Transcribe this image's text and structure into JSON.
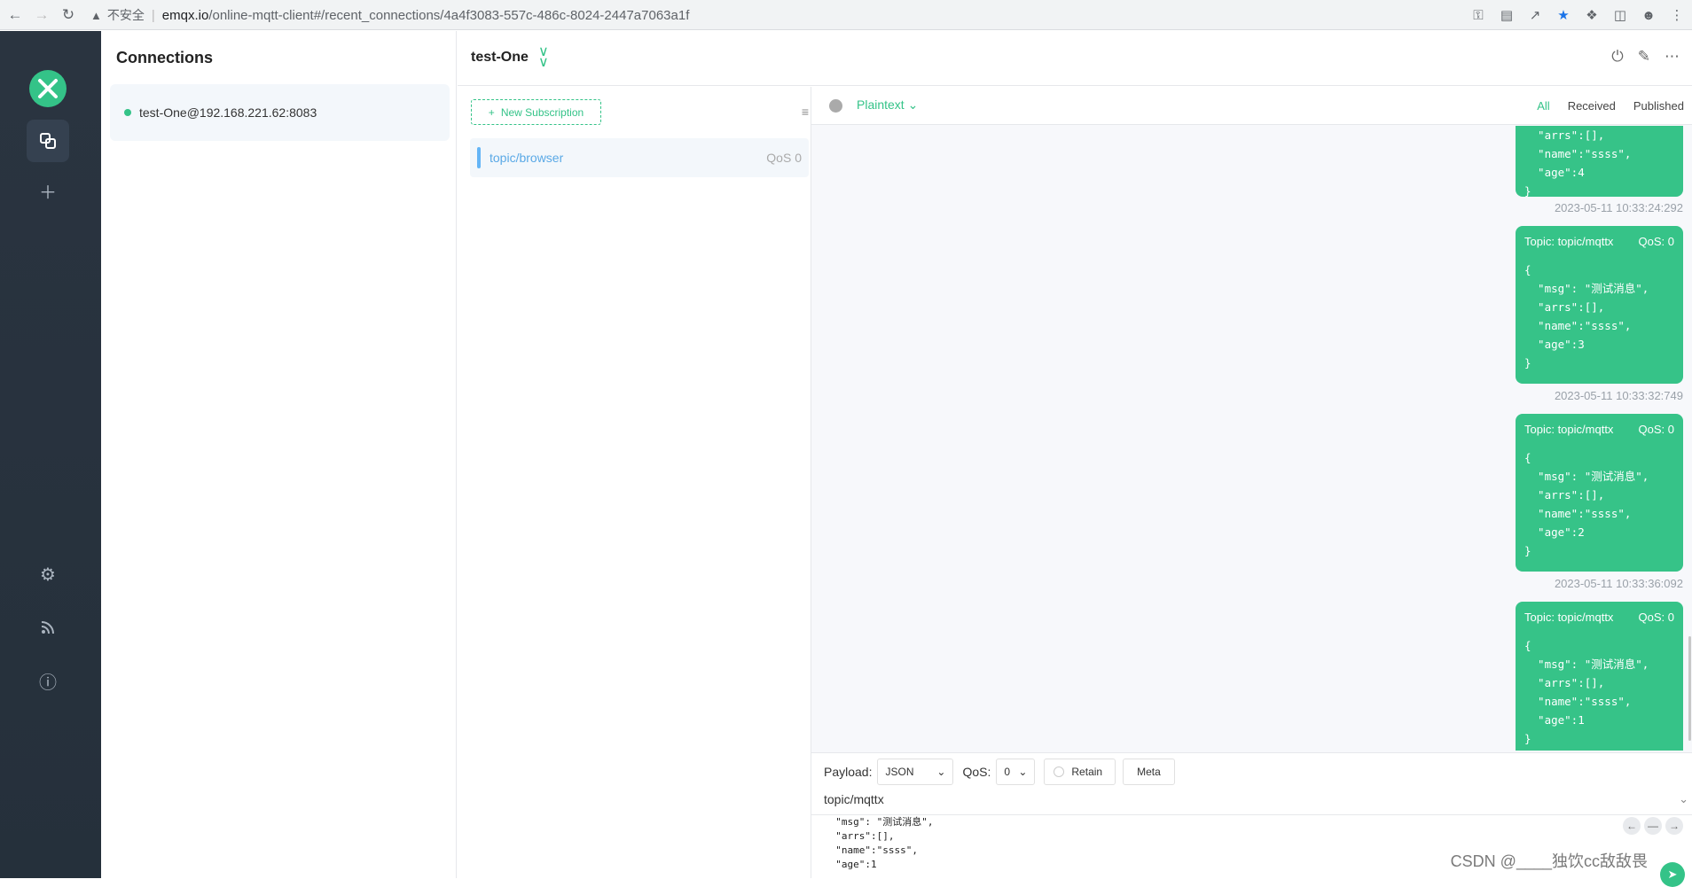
{
  "browser": {
    "insecure_label": "不安全",
    "host": "emqx.io",
    "path": "/online-mqtt-client#/recent_connections/4a4f3083-557c-486c-8024-2447a7063a1f"
  },
  "connections": {
    "title": "Connections",
    "items": [
      {
        "label": "test-One@192.168.221.62:8083",
        "status": "connected"
      }
    ]
  },
  "header": {
    "connection_name": "test-One"
  },
  "subscriptions": {
    "new_button": "New Subscription",
    "items": [
      {
        "topic": "topic/browser",
        "qos": "QoS 0",
        "color": "#64b5f6"
      }
    ]
  },
  "messages": {
    "format": "Plaintext",
    "filters": [
      "All",
      "Received",
      "Published"
    ],
    "items": [
      {
        "topic": "",
        "qos": "",
        "body": "  \"arrs\":[],\n  \"name\":\"ssss\",\n  \"age\":4\n}",
        "time": "2023-05-11 10:33:24:292"
      },
      {
        "topic": "Topic: topic/mqttx",
        "qos": "QoS: 0",
        "body": "{\n  \"msg\": \"测试消息\",\n  \"arrs\":[],\n  \"name\":\"ssss\",\n  \"age\":3\n}",
        "time": "2023-05-11 10:33:32:749"
      },
      {
        "topic": "Topic: topic/mqttx",
        "qos": "QoS: 0",
        "body": "{\n  \"msg\": \"测试消息\",\n  \"arrs\":[],\n  \"name\":\"ssss\",\n  \"age\":2\n}",
        "time": "2023-05-11 10:33:36:092"
      },
      {
        "topic": "Topic: topic/mqttx",
        "qos": "QoS: 0",
        "body": "{\n  \"msg\": \"测试消息\",\n  \"arrs\":[],\n  \"name\":\"ssss\",\n  \"age\":1\n}",
        "time": ""
      }
    ]
  },
  "composer": {
    "payload_label": "Payload:",
    "payload_format": "JSON",
    "qos_label": "QoS:",
    "qos_value": "0",
    "retain_label": "Retain",
    "meta_label": "Meta",
    "topic": "topic/mqttx",
    "payload": "  \"msg\": \"测试消息\",\n  \"arrs\":[],\n  \"name\":\"ssss\",\n  \"age\":1"
  },
  "watermark": "CSDN @____独饮cc敌敌畏",
  "colors": {
    "accent": "#34c388",
    "sidebar": "#2a3440"
  }
}
